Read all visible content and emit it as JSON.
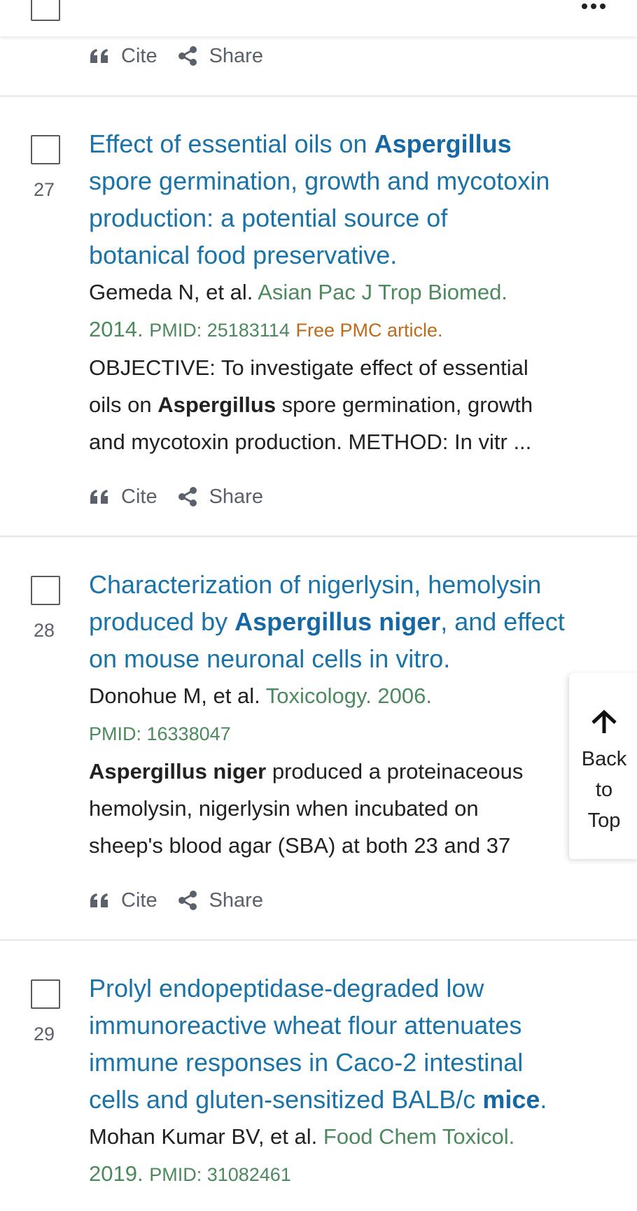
{
  "header": {
    "more_label": "More actions"
  },
  "actions": {
    "cite": "Cite",
    "share": "Share"
  },
  "articles": [
    {
      "number": "27",
      "title_lines": [
        [
          "Effect of essential oils on ",
          "Aspergillus",
          ""
        ],
        [
          "spore germination, growth and mycotoxin"
        ],
        [
          "production: a potential source of"
        ],
        [
          "botanical food preservative."
        ]
      ],
      "authors": "Gemeda N, et al.",
      "journal_line1": "Asian Pac J Trop Biomed.",
      "year": "2014.",
      "pmid": "PMID: 25183114",
      "free_pmc": "Free PMC article.",
      "snippet": {
        "l1": "OBJECTIVE: To investigate effect of essential",
        "l2_pre": "oils on ",
        "l2_bold": "Aspergillus",
        "l2_post": " spore germination, growth",
        "l3": "and mycotoxin production. METHOD: In vitr ..."
      }
    },
    {
      "number": "28",
      "title_l1": "Characterization of nigerlysin, hemolysin",
      "title_l2_pre": "produced by ",
      "title_l2_bold": "Aspergillus niger",
      "title_l2_post": ", and effect",
      "title_l3": "on mouse neuronal cells in vitro.",
      "authors": "Donohue M, et al.",
      "journal": "Toxicology. 2006.",
      "pmid": "PMID: 16338047",
      "snippet": {
        "l1_bold": "Aspergillus niger",
        "l1_post": " produced a proteinaceous",
        "l2": "hemolysin, nigerlysin when incubated on",
        "l3": "sheep's blood agar (SBA) at both 23 and 37"
      }
    },
    {
      "number": "29",
      "title_l1": "Prolyl endopeptidase-degraded low",
      "title_l2": "immunoreactive wheat flour attenuates",
      "title_l3": "immune responses in Caco-2 intestinal",
      "title_l4_pre": "cells and gluten-sensitized BALB/c ",
      "title_l4_bold": "mice",
      "title_l4_post": ".",
      "authors": "Mohan Kumar BV, et al.",
      "journal_line1": "Food Chem Toxicol.",
      "year": "2019.",
      "pmid": "PMID: 31082461"
    }
  ],
  "back_to_top": {
    "l1": "Back",
    "l2": "to",
    "l3": "Top"
  },
  "colors": {
    "link": "#1a73a8",
    "journal": "#4c8a5e",
    "free_pmc": "#bd6b1c"
  }
}
